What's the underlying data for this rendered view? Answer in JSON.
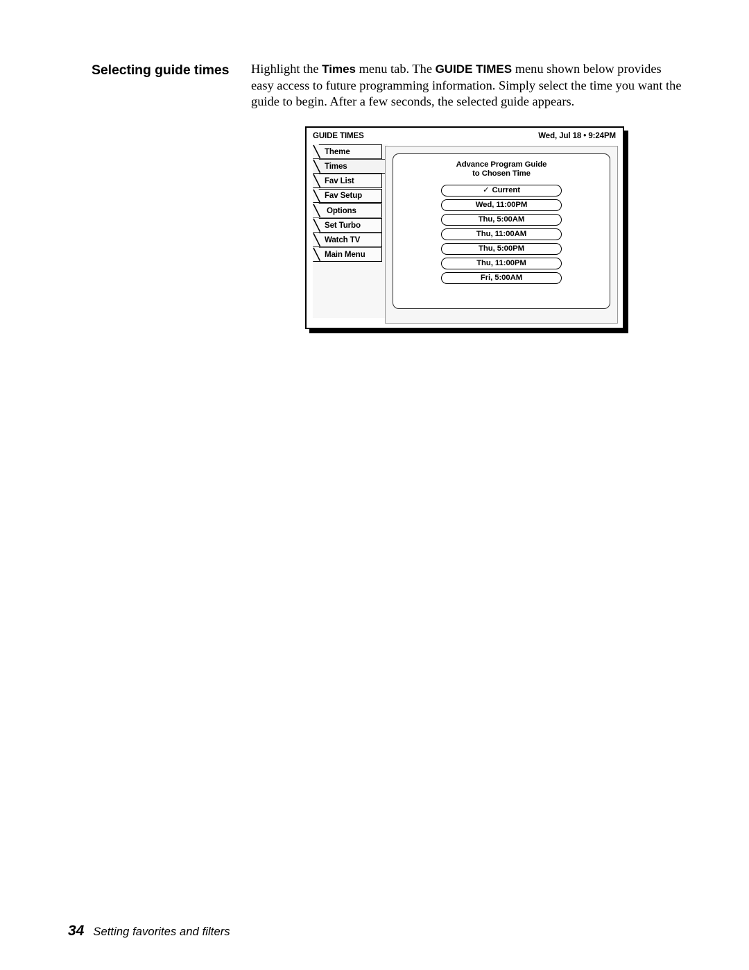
{
  "page": {
    "section_heading": "Selecting guide times",
    "body_parts": [
      {
        "text": "Highlight the ",
        "style": "normal"
      },
      {
        "text": "Times",
        "style": "bold-sans"
      },
      {
        "text": " menu tab. The ",
        "style": "normal"
      },
      {
        "text": "GUIDE TIMES",
        "style": "bold-sans"
      },
      {
        "text": " menu shown below provides easy access to future programming information. Simply select the time you want the guide to begin. After a few seconds, the selected guide appears.",
        "style": "normal"
      }
    ],
    "body_plain": "Highlight the Times menu tab. The GUIDE TIMES menu shown below provides easy access to future programming information. Simply select the time you want the guide to begin. After a few seconds, the selected guide appears."
  },
  "tv_screen": {
    "header": {
      "title": "GUIDE TIMES",
      "clock": "Wed, Jul 18 • 9:24PM"
    },
    "tabs": [
      {
        "label": "Theme",
        "selected": false,
        "indent": false
      },
      {
        "label": "Times",
        "selected": true,
        "indent": false
      },
      {
        "label": "Fav List",
        "selected": false,
        "indent": false
      },
      {
        "label": "Fav Setup",
        "selected": false,
        "indent": false
      },
      {
        "label": "Options",
        "selected": false,
        "indent": true
      },
      {
        "label": "Set Turbo",
        "selected": false,
        "indent": false
      },
      {
        "label": "Watch TV",
        "selected": false,
        "indent": false
      },
      {
        "label": "Main Menu",
        "selected": false,
        "indent": false
      }
    ],
    "panel": {
      "card_title_line1": "Advance Program Guide",
      "card_title_line2": "to Chosen Time",
      "times": [
        {
          "label": "Current",
          "checked": true,
          "check_glyph": "✓"
        },
        {
          "label": "Wed,  11:00PM",
          "checked": false,
          "check_glyph": ""
        },
        {
          "label": "Thu,   5:00AM",
          "checked": false,
          "check_glyph": ""
        },
        {
          "label": "Thu,  11:00AM",
          "checked": false,
          "check_glyph": ""
        },
        {
          "label": "Thu,  5:00PM",
          "checked": false,
          "check_glyph": ""
        },
        {
          "label": "Thu,  11:00PM",
          "checked": false,
          "check_glyph": ""
        },
        {
          "label": "Fri,   5:00AM",
          "checked": false,
          "check_glyph": ""
        }
      ]
    }
  },
  "footer": {
    "page_number": "34",
    "running_head": "Setting favorites and filters"
  },
  "colors": {
    "ink": "#000000",
    "paper": "#ffffff",
    "panel_bg": "#f6f6f6",
    "tab_bg": "#fbfbfb",
    "tab_selected_bg": "#f3f3f3",
    "panel_border": "#9a9a9a"
  }
}
